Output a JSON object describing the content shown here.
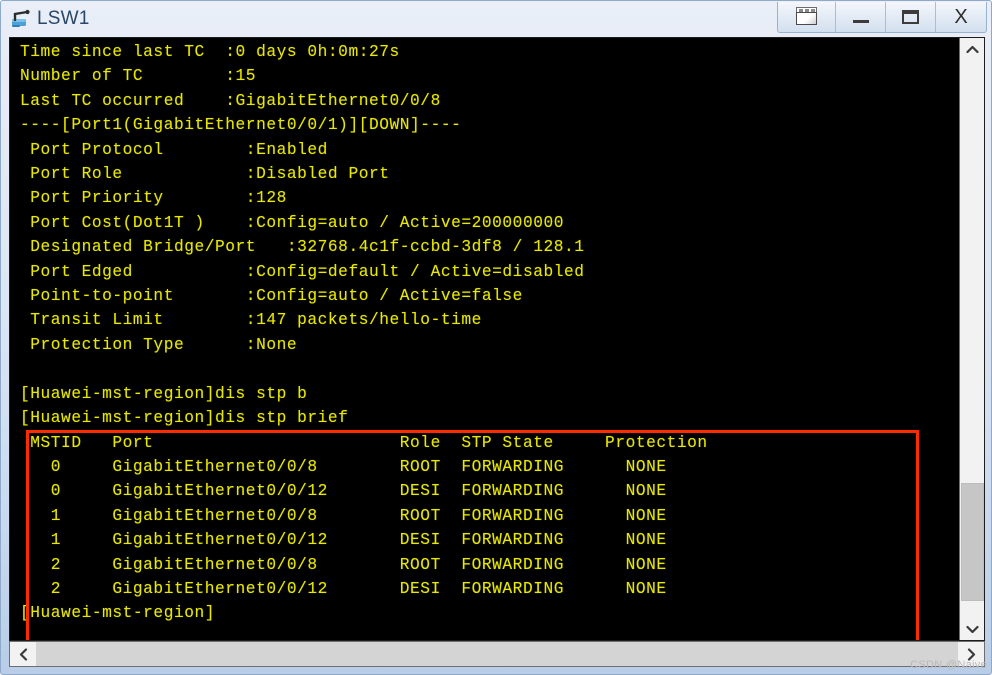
{
  "window": {
    "title": "LSW1",
    "icon": "switch-icon",
    "controls": [
      {
        "name": "restore-windows-button",
        "label": "❐"
      },
      {
        "name": "minimize-button",
        "label": "—"
      },
      {
        "name": "maximize-button",
        "label": "□"
      },
      {
        "name": "close-button",
        "label": "X"
      }
    ]
  },
  "terminal": {
    "foreground_color": "#e8e800",
    "background_color": "#000000",
    "lines": [
      "Time since last TC  :0 days 0h:0m:27s",
      "Number of TC        :15",
      "Last TC occurred    :GigabitEthernet0/0/8",
      "----[Port1(GigabitEthernet0/0/1)][DOWN]----",
      " Port Protocol        :Enabled",
      " Port Role            :Disabled Port",
      " Port Priority        :128",
      " Port Cost(Dot1T )    :Config=auto / Active=200000000",
      " Designated Bridge/Port   :32768.4c1f-ccbd-3df8 / 128.1",
      " Port Edged           :Config=default / Active=disabled",
      " Point-to-point       :Config=auto / Active=false",
      " Transit Limit        :147 packets/hello-time",
      " Protection Type      :None",
      "",
      "[Huawei-mst-region]dis stp b",
      "[Huawei-mst-region]dis stp brief",
      " MSTID   Port                        Role  STP State     Protection",
      "   0     GigabitEthernet0/0/8        ROOT  FORWARDING      NONE",
      "   0     GigabitEthernet0/0/12       DESI  FORWARDING      NONE",
      "   1     GigabitEthernet0/0/8        ROOT  FORWARDING      NONE",
      "   1     GigabitEthernet0/0/12       DESI  FORWARDING      NONE",
      "   2     GigabitEthernet0/0/8        ROOT  FORWARDING      NONE",
      "   2     GigabitEthernet0/0/12       DESI  FORWARDING      NONE",
      "[Huawei-mst-region]"
    ],
    "stp_brief_table": {
      "columns": [
        "MSTID",
        "Port",
        "Role",
        "STP State",
        "Protection"
      ],
      "rows": [
        [
          "0",
          "GigabitEthernet0/0/8",
          "ROOT",
          "FORWARDING",
          "NONE"
        ],
        [
          "0",
          "GigabitEthernet0/0/12",
          "DESI",
          "FORWARDING",
          "NONE"
        ],
        [
          "1",
          "GigabitEthernet0/0/8",
          "ROOT",
          "FORWARDING",
          "NONE"
        ],
        [
          "1",
          "GigabitEthernet0/0/12",
          "DESI",
          "FORWARDING",
          "NONE"
        ],
        [
          "2",
          "GigabitEthernet0/0/8",
          "ROOT",
          "FORWARDING",
          "NONE"
        ],
        [
          "2",
          "GigabitEthernet0/0/12",
          "DESI",
          "FORWARDING",
          "NONE"
        ]
      ]
    },
    "prompt": "[Huawei-mst-region]",
    "commands": [
      "dis stp b",
      "dis stp brief"
    ]
  },
  "annotation": {
    "highlight_color": "#ff2b00",
    "shape": "rectangle"
  },
  "scrollbars": {
    "vertical": {
      "up_arrow": "▲",
      "down_arrow": "▼"
    },
    "horizontal": {
      "left_arrow": "‹",
      "right_arrow": "›"
    }
  },
  "watermark": "CSDN @Naive"
}
